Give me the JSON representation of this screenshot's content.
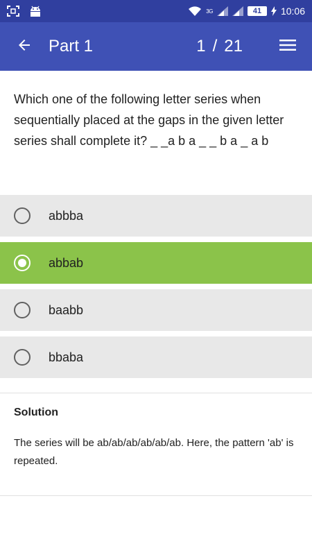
{
  "status_bar": {
    "time": "10:06",
    "battery": "41",
    "network_label": "3G",
    "icons": [
      "screenshot-icon",
      "android-icon",
      "wifi-icon",
      "signal-icon",
      "signal-icon-2",
      "charging-icon"
    ]
  },
  "app_bar": {
    "title": "Part 1",
    "current": "1",
    "separator": "/",
    "total": "21",
    "back_icon": "arrow-left-icon",
    "menu_icon": "hamburger-menu-icon",
    "color": "#3f51b5",
    "status_color": "#303f9f"
  },
  "question": {
    "text": "Which one of the following letter series when sequentially placed at the gaps in the given letter series shall complete it? _ _a b a _ _ b a _ a b"
  },
  "options": [
    {
      "label": "abbba",
      "selected": false
    },
    {
      "label": "abbab",
      "selected": true
    },
    {
      "label": "baabb",
      "selected": false
    },
    {
      "label": "bbaba",
      "selected": false
    }
  ],
  "selected_color": "#8bc34a",
  "solution": {
    "title": "Solution",
    "text": "The series will be ab/ab/ab/ab/ab/ab. Here, the pattern 'ab' is repeated."
  }
}
